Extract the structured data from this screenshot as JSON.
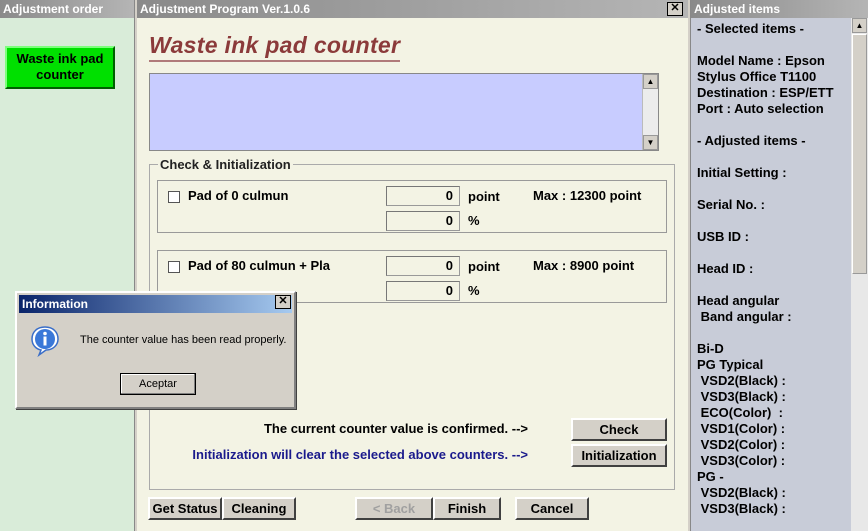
{
  "left_panel": {
    "title": "Adjustment order",
    "waste_button": "Waste ink pad counter"
  },
  "center_panel": {
    "title": "Adjustment Program Ver.1.0.6",
    "close_glyph": "✕",
    "heading": "Waste ink pad counter",
    "group_title": "Check & Initialization",
    "pads": [
      {
        "label": "Pad  of 0 culmun",
        "point_value": "0",
        "point_unit": "point",
        "percent_value": "0",
        "percent_unit": "%",
        "max": "Max : 12300 point",
        "checked": false
      },
      {
        "label": "Pad  of 80 culmun + Pla",
        "point_value": "0",
        "point_unit": "point",
        "percent_value": "0",
        "percent_unit": "%",
        "max": "Max : 8900 point",
        "checked": false
      }
    ],
    "confirm_text": "The current counter value is confirmed. -->",
    "init_text": "Initialization will clear the selected above counters. -->",
    "check_button": "Check",
    "initialization_button": "Initialization",
    "bottom_buttons": {
      "get_status": "Get Status",
      "cleaning": "Cleaning",
      "back": "< Back",
      "finish": "Finish",
      "cancel": "Cancel"
    },
    "colors": {
      "heading": "#8b3a3a",
      "init_text": "#1a1a8c",
      "log_area": "#c8ccff"
    }
  },
  "right_panel": {
    "title": "Adjusted items",
    "lines": [
      "- Selected items -",
      "",
      "Model Name : Epson",
      "Stylus Office T1100",
      "Destination : ESP/ETT",
      "Port : Auto selection",
      "",
      "- Adjusted items -",
      "",
      "Initial Setting :",
      "",
      "Serial No. :",
      "",
      "USB ID :",
      "",
      "Head ID :",
      "",
      "Head angular",
      " Band angular :",
      "",
      "Bi-D",
      "PG Typical",
      " VSD2(Black) :",
      " VSD3(Black) :",
      " ECO(Color)  :",
      " VSD1(Color) :",
      " VSD2(Color) :",
      " VSD3(Color) :",
      "PG -",
      " VSD2(Black) :",
      " VSD3(Black) :"
    ]
  },
  "dialog": {
    "title": "Information",
    "message": "The counter value has been read properly.",
    "ok_button": "Aceptar",
    "icon": "info-icon",
    "close_glyph": "✕"
  }
}
